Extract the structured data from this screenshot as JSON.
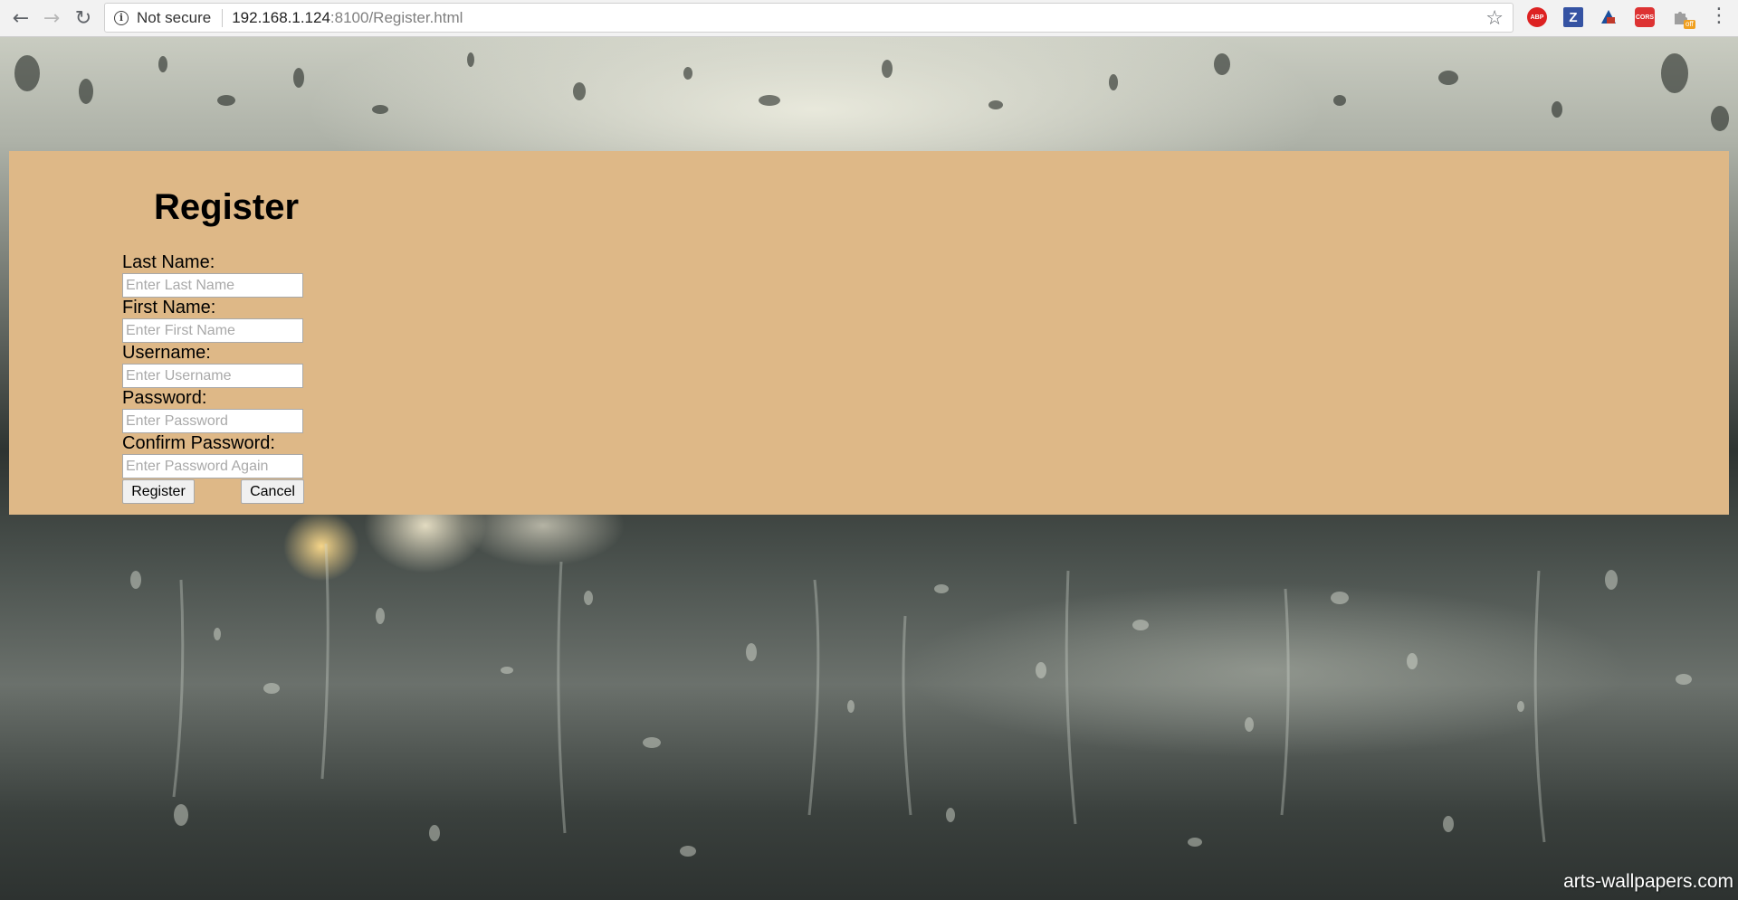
{
  "browser": {
    "security_label": "Not secure",
    "url_host": "192.168.1.124",
    "url_rest": ":8100/Register.html",
    "extensions": [
      {
        "name": "adblock-plus-icon",
        "text": "ABP"
      },
      {
        "name": "zotero-icon",
        "text": "Z"
      },
      {
        "name": "ie-tab-icon",
        "text": ""
      },
      {
        "name": "cors-icon",
        "text": "CORS"
      },
      {
        "name": "extension-puzzle-icon",
        "text": ""
      }
    ],
    "off_badge": "off"
  },
  "page": {
    "title": "Register",
    "fields": [
      {
        "label": "Last Name:",
        "placeholder": "Enter Last Name",
        "value": ""
      },
      {
        "label": "First Name:",
        "placeholder": "Enter First Name",
        "value": ""
      },
      {
        "label": "Username:",
        "placeholder": "Enter Username",
        "value": ""
      },
      {
        "label": "Password:",
        "placeholder": "Enter Password",
        "value": ""
      },
      {
        "label": "Confirm Password:",
        "placeholder": "Enter Password Again",
        "value": ""
      }
    ],
    "register_label": "Register",
    "cancel_label": "Cancel",
    "panel_color": "#deb887"
  },
  "watermark": "arts-wallpapers.com"
}
